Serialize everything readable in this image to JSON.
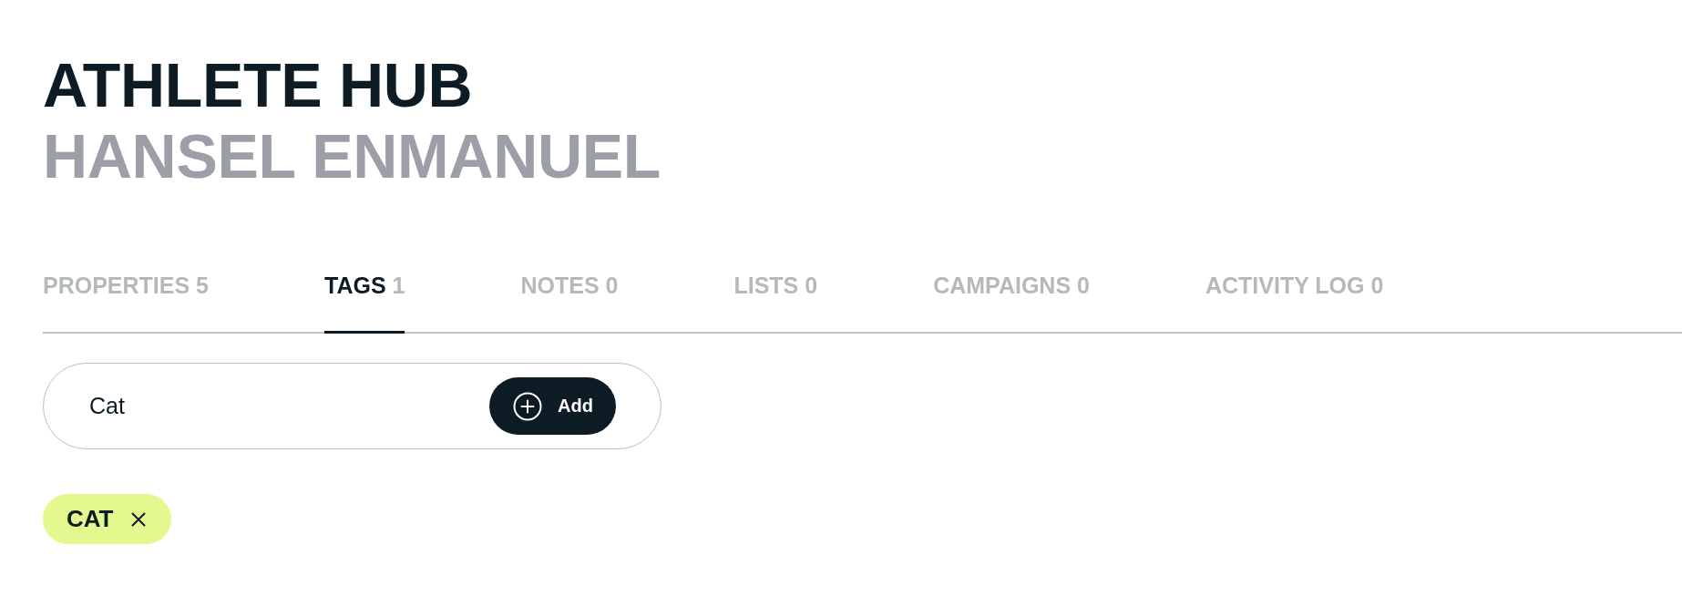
{
  "header": {
    "title": "ATHLETE HUB",
    "subtitle": "HANSEL ENMANUEL"
  },
  "tabs": [
    {
      "label": "PROPERTIES",
      "count": "5",
      "selected": false
    },
    {
      "label": "TAGS",
      "count": "1",
      "selected": true
    },
    {
      "label": "NOTES",
      "count": "0",
      "selected": false
    },
    {
      "label": "LISTS",
      "count": "0",
      "selected": false
    },
    {
      "label": "CAMPAIGNS",
      "count": "0",
      "selected": false
    },
    {
      "label": "ACTIVITY LOG",
      "count": "0",
      "selected": false
    }
  ],
  "tag_input": {
    "value": "Cat",
    "button": "Add"
  },
  "tags": [
    {
      "label": "CAT"
    }
  ]
}
